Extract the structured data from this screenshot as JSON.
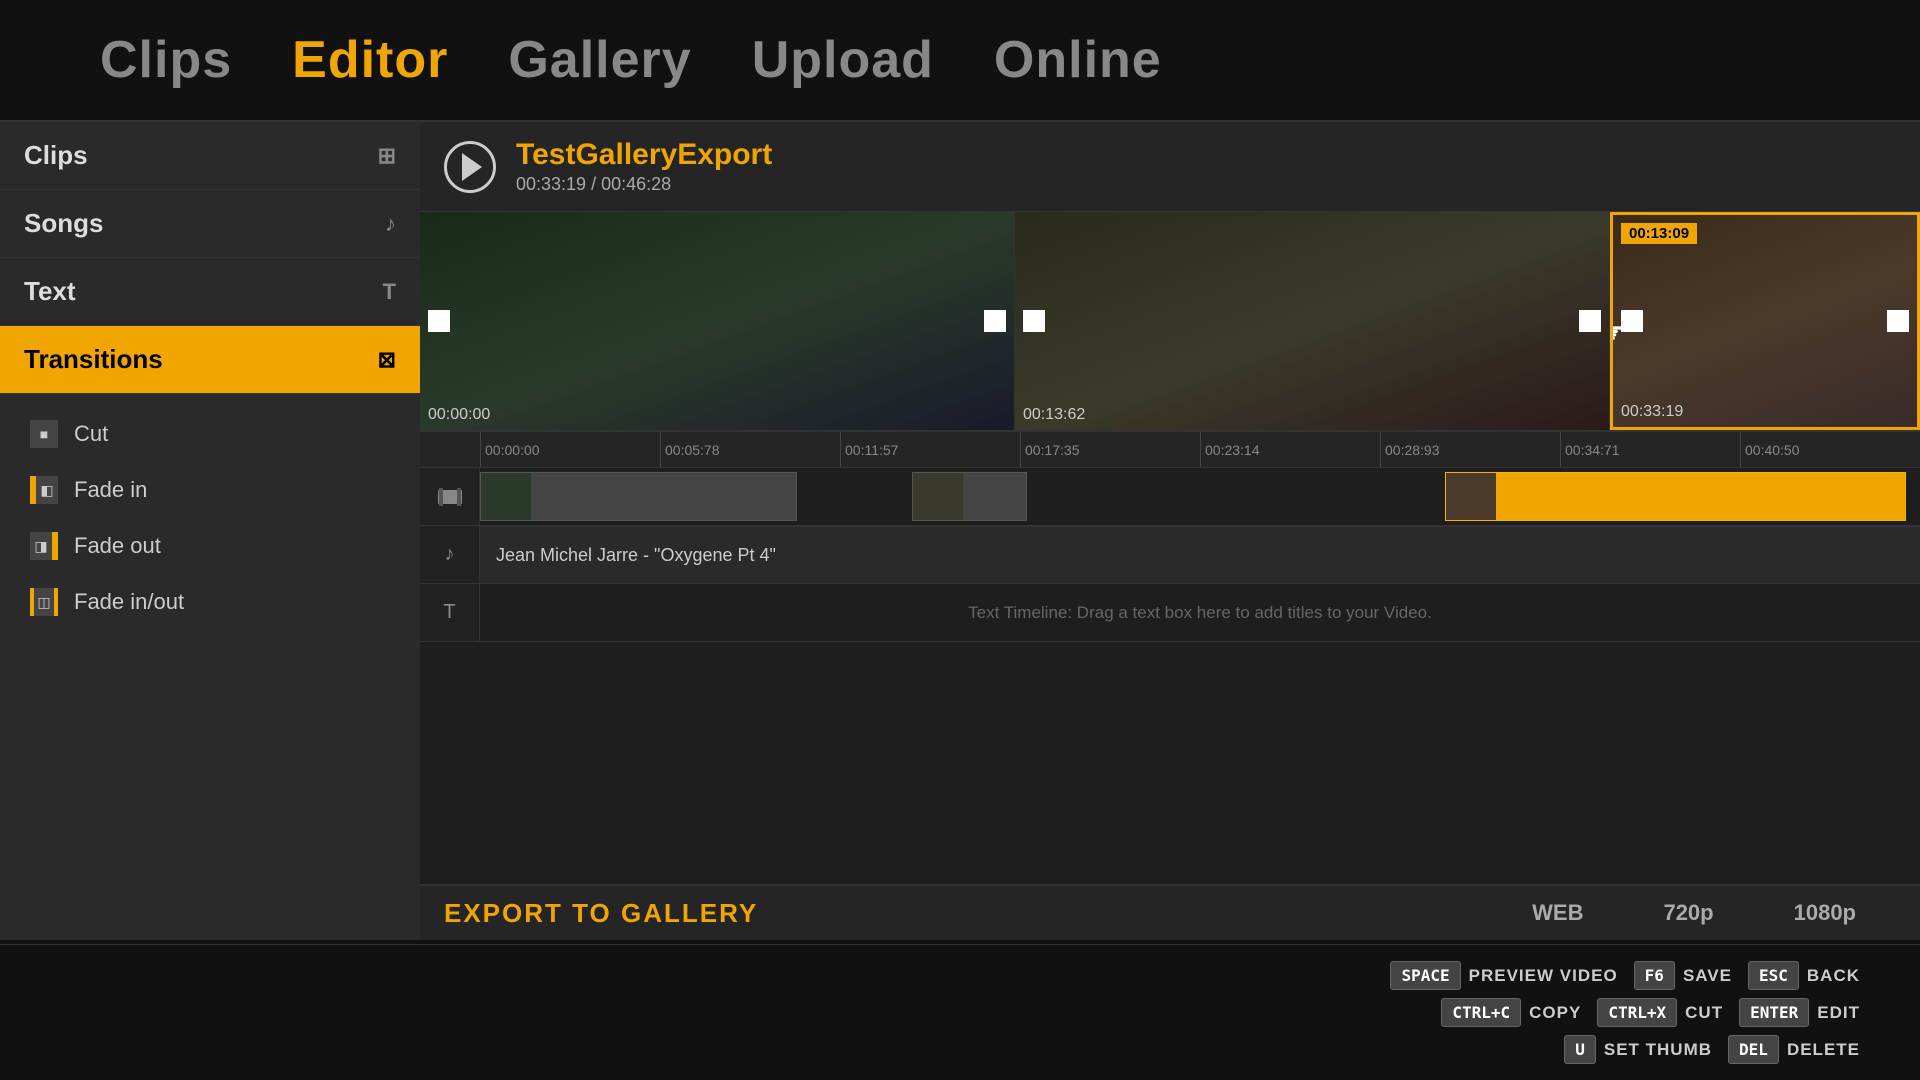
{
  "nav": {
    "items": [
      {
        "label": "Clips",
        "active": false
      },
      {
        "label": "Editor",
        "active": true
      },
      {
        "label": "Gallery",
        "active": false
      },
      {
        "label": "Upload",
        "active": false
      },
      {
        "label": "Online",
        "active": false
      }
    ]
  },
  "sidebar": {
    "items": [
      {
        "label": "Clips",
        "icon": "⊞",
        "active": false
      },
      {
        "label": "Songs",
        "icon": "♪",
        "active": false
      },
      {
        "label": "Text",
        "icon": "T",
        "active": false
      },
      {
        "label": "Transitions",
        "icon": "⊠",
        "active": true
      }
    ],
    "transitions": [
      {
        "label": "Cut",
        "type": "cut"
      },
      {
        "label": "Fade in",
        "type": "fadein"
      },
      {
        "label": "Fade out",
        "type": "fadeout"
      },
      {
        "label": "Fade in/out",
        "type": "fadeinout"
      }
    ]
  },
  "video": {
    "title": "TestGalleryExport",
    "current_time": "00:33:19",
    "total_time": "00:46:28"
  },
  "previews": [
    {
      "time_badge": null,
      "timestamp": "00:00:00",
      "selected": false
    },
    {
      "time_badge": null,
      "timestamp": "00:13:62",
      "selected": false
    },
    {
      "time_badge": "00:13:09",
      "timestamp": "00:33:19",
      "selected": true
    }
  ],
  "timeline": {
    "ruler_marks": [
      "00:00:00",
      "00:05:78",
      "00:11:57",
      "00:17:35",
      "00:23:14",
      "00:28:93",
      "00:34:71",
      "00:40:50"
    ],
    "music_track": "Jean Michel Jarre  - \"Oxygene Pt 4\"",
    "text_timeline_hint": "Text Timeline: Drag a text box here to add titles to your Video."
  },
  "export": {
    "button_label": "EXPORT TO GALLERY",
    "quality_options": [
      "WEB",
      "720p",
      "1080p"
    ]
  },
  "hotkeys": {
    "row1": [
      {
        "key": "SPACE",
        "label": "PREVIEW VIDEO"
      },
      {
        "key": "F6",
        "label": "SAVE"
      },
      {
        "key": "ESC",
        "label": "BACK"
      }
    ],
    "row2": [
      {
        "key": "CTRL+C",
        "label": "COPY"
      },
      {
        "key": "CTRL+X",
        "label": "CUT"
      },
      {
        "key": "ENTER",
        "label": "EDIT"
      }
    ],
    "row3": [
      {
        "key": "U",
        "label": "SET THUMB"
      },
      {
        "key": "DEL",
        "label": "DELETE"
      }
    ]
  }
}
